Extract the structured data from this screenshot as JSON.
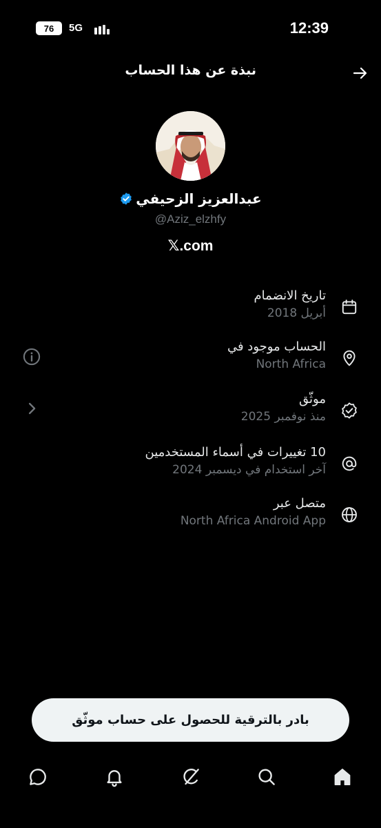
{
  "status_bar": {
    "battery": "76",
    "network": "5G",
    "time": "12:39"
  },
  "header": {
    "title": "نبذة عن هذا الحساب",
    "back_icon": "arrow-right-icon"
  },
  "profile": {
    "name": "عبدالعزيز الزحيفي",
    "handle": "@Aziz_elzhfy",
    "site_glyph": "𝕏",
    "site_suffix": ".com",
    "verified_color": "#1d9bf0"
  },
  "info": [
    {
      "icon": "calendar-icon",
      "title": "تاريخ الانضمام",
      "sub": "أبريل 2018"
    },
    {
      "icon": "location-pin-icon",
      "title": "الحساب موجود في",
      "sub": "North Africa"
    },
    {
      "icon": "verified-check-icon",
      "title": "موثّق",
      "sub": "منذ نوفمبر 2025"
    },
    {
      "icon": "at-sign-icon",
      "title": "10 تغييرات في أسماء المستخدمين",
      "sub": "آخر استخدام في ديسمبر 2024"
    },
    {
      "icon": "globe-icon",
      "title": "متصل عبر",
      "sub": "North Africa Android App"
    }
  ],
  "upgrade_button": {
    "label": "بادر بالترقية للحصول على حساب موثّق"
  },
  "nav": [
    "chat-icon",
    "bell-icon",
    "grok-icon",
    "search-icon",
    "home-icon"
  ],
  "colors": {
    "background": "#000000",
    "primary_text": "#e7e9ea",
    "secondary_text": "#71767b",
    "button_bg": "#eff3f4"
  }
}
